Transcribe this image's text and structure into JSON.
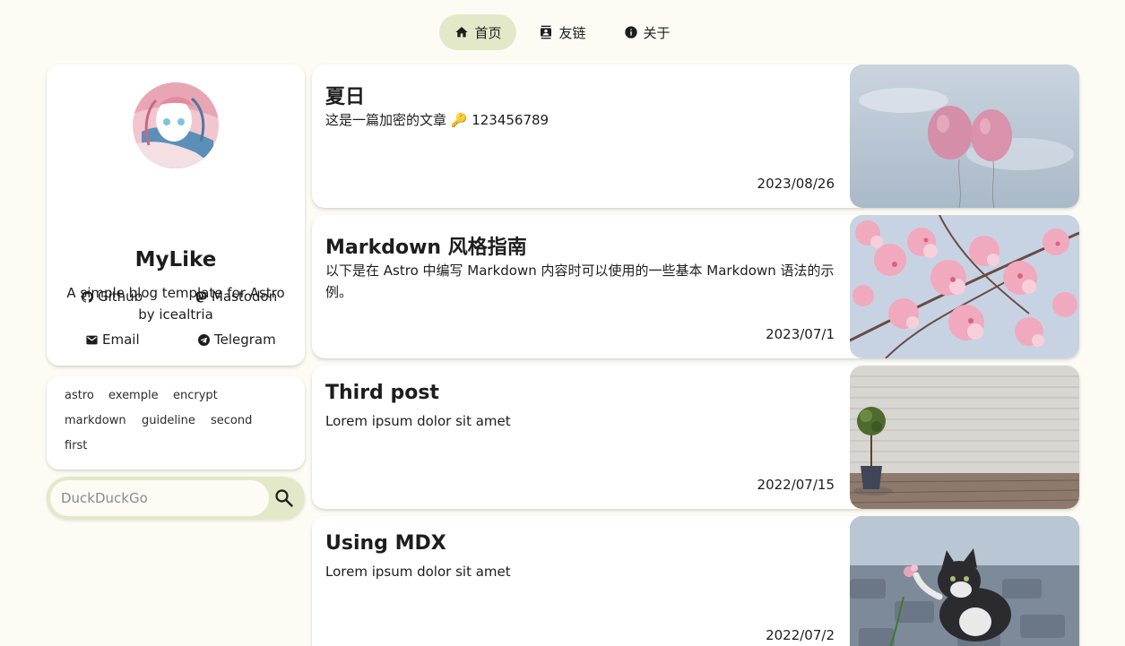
{
  "nav": {
    "items": [
      {
        "label": "首页",
        "icon": "home-icon",
        "active": true
      },
      {
        "label": "友链",
        "icon": "contacts-icon",
        "active": false
      },
      {
        "label": "关于",
        "icon": "info-icon",
        "active": false
      }
    ]
  },
  "profile": {
    "name": "MyLike",
    "description": "A simple blog template for Astro by icealtria",
    "links": [
      {
        "label": "Github",
        "icon": "github-icon"
      },
      {
        "label": "Mastodon",
        "icon": "mastodon-icon"
      },
      {
        "label": "Email",
        "icon": "email-icon"
      },
      {
        "label": "Telegram",
        "icon": "telegram-icon"
      }
    ]
  },
  "tags": [
    "astro",
    "exemple",
    "encrypt",
    "markdown",
    "guideline",
    "second",
    "first"
  ],
  "search": {
    "placeholder": "DuckDuckGo"
  },
  "posts": [
    {
      "title": "夏日",
      "desc": "这是一篇加密的文章 🔑 123456789",
      "date": "2023/08/26",
      "image": "pink-balloons"
    },
    {
      "title": "Markdown 风格指南",
      "desc": "以下是在 Astro 中编写 Markdown 内容时可以使用的一些基本 Markdown 语法的示例。",
      "date": "2023/07/1",
      "image": "cherry-blossoms"
    },
    {
      "title": "Third post",
      "desc": "Lorem ipsum dolor sit amet",
      "date": "2022/07/15",
      "image": "brick-wall-plant"
    },
    {
      "title": "Using MDX",
      "desc": "Lorem ipsum dolor sit amet",
      "date": "2022/07/2",
      "image": "kitten-flower"
    }
  ],
  "colors": {
    "background": "#fcfcf5",
    "accent": "#e3e9c8",
    "card": "#ffffff"
  }
}
